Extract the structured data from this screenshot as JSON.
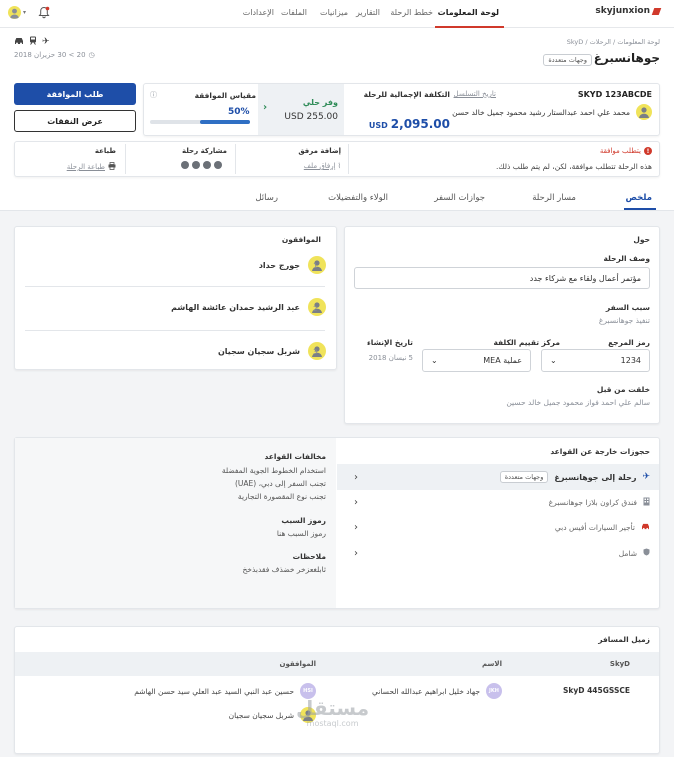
{
  "app": {
    "brand": "skyjunxion"
  },
  "nav": {
    "tabs": [
      "لوحة المعلومات",
      "خطط الرحلة",
      "التقارير",
      "ميزانيات",
      "الملفات",
      "الإعدادات"
    ],
    "active_index": 0
  },
  "breadcrumb": {
    "path": "لوحة المعلومات / الرحلات / SkyD"
  },
  "trip": {
    "title": "جوهانسبرغ",
    "tag": "وجهات متعددة",
    "dates": "20 > 30 حزيران 2018",
    "ref": "SKYD 123ABCDE",
    "history_link": "تاريخ التسلسل",
    "traveler": "محمد علي احمد عبدالستار رشيد محمود جميل خالد حسن",
    "total_label": "التكلفة الإجمالية للرحلة",
    "total_currency": "USD",
    "total_value": "2,095.00",
    "savings_label": "وفر حلي",
    "savings_value": "USD 255.00",
    "gauge_label": "مقياس الموافقة",
    "gauge_percent": "50%",
    "gauge_fraction": 0.5,
    "approve_button": "طلب الموافقة",
    "expenses_button": "عرض النفقات"
  },
  "alert": {
    "title": "يتطلب موافقة",
    "text": "هذه الرحلة تتطلب موافقة، لكن، لم يتم طلب ذلك."
  },
  "actions": {
    "attachment_label": "إضافة مرفق",
    "attachment_link": "إرفاق ملف",
    "share_label": "مشاركة رحلة",
    "print_label": "طباعة",
    "print_link": "طباعة الرحلة"
  },
  "tabs": {
    "items": [
      "ملخص",
      "مسار الرحلة",
      "جوازات السفر",
      "الولاء والتفضيلات",
      "رسائل"
    ],
    "active_index": 0
  },
  "about": {
    "heading": "حول",
    "desc_label": "وصف الرحلة",
    "desc_value": "مؤتمر أعمال ولقاء مع شركاء جدد",
    "reason_label": "سبب السفر",
    "reason_value": "تنفيذ جوهانسبرغ",
    "ref_code_label": "رمز المرجع",
    "ref_code_value": "1234",
    "cost_center_label": "مركز تقييم الكلفة",
    "cost_center_value": "عملية MEA",
    "created_label": "تاريخ الإنشاء",
    "created_value": "5 نيسان 2018",
    "created_by_label": "خلقت من قبل",
    "created_by_value": "سالم علي احمد فواز محمود جميل خالد حسين"
  },
  "approvers": {
    "heading": "الموافقون",
    "items": [
      {
        "num": "1",
        "name": "جورج حداد"
      },
      {
        "num": "2",
        "name": "عبد الرشيد حمدان عائشة الهاشم"
      },
      {
        "num": "3",
        "name": "شربل سجيان سجيان"
      }
    ]
  },
  "violations": {
    "heading": "حجوزات خارجة عن القواعد",
    "items": [
      {
        "label": "رحلة إلى جوهانسبرغ",
        "tag": "وجهات متعددة",
        "icon": "plane-icon"
      },
      {
        "label": "فندق كراون بلازا جوهانسبرغ",
        "tag": "",
        "icon": "building-icon"
      },
      {
        "label": "تأجير السيارات أفيس دبي",
        "tag": "",
        "icon": "car-icon"
      },
      {
        "label": "شامل",
        "tag": "",
        "icon": "shield-icon"
      }
    ],
    "rules_label": "مخالفات القواعد",
    "rules": [
      "استخدام الخطوط الجوية المفضلة",
      "تجنب السفر إلى دبي، (UAE)",
      "تجنب نوع المقصورة التجارية"
    ],
    "reason_codes_label": "رموز السبب",
    "reason_codes_value": "رموز السبب هنا",
    "notes_label": "ملاحظات",
    "notes_value": "ثابلغعزخر خضذف فقدبذخخ"
  },
  "companion": {
    "heading": "زميل المسافر",
    "col_skyd": "SkyD",
    "col_name": "الاسم",
    "col_approvers": "الموافقون",
    "skyd": "SkyD 445GSSCE",
    "name": "جهاد خليل ابراهيم عبدالله الحساني",
    "name_initials": "JKH",
    "approver1": "حسين عبد النبي السيد عبد العلي سيد حسن الهاشم",
    "approver1_initials": "HSI",
    "approver2": "شربل سجيان سجيان"
  },
  "watermark": {
    "brand": "مستقل",
    "domain": "mostaql.com"
  },
  "colors": {
    "primary": "#1e4ea8",
    "accent_red": "#d0392b",
    "gauge": "#2f6fc4",
    "savings": "#2e8b57"
  }
}
